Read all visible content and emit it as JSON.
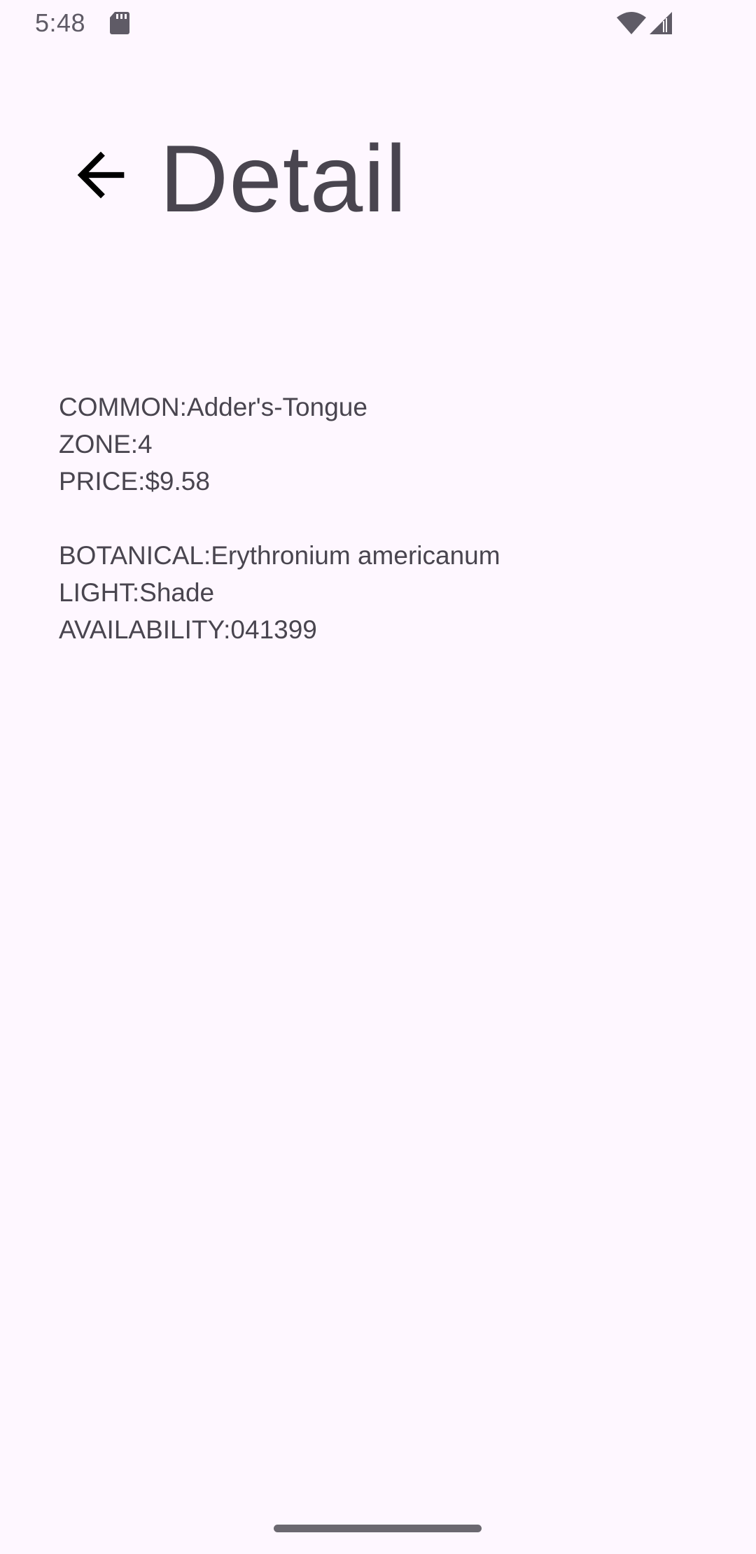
{
  "status_bar": {
    "time": "5:48",
    "icons": [
      "sd-card-icon",
      "wifi-icon",
      "cell-signal-icon"
    ]
  },
  "top_bar": {
    "back_icon": "arrow-back-icon",
    "title": "Detail"
  },
  "details": {
    "common": "COMMON:Adder's-Tongue",
    "zone": "ZONE:4",
    "price": "PRICE:$9.58",
    "botanical": "BOTANICAL:Erythronium americanum",
    "light": "LIGHT:Shade",
    "availability": "AVAILABILITY:041399"
  },
  "colors": {
    "background": "#FEF7FF",
    "text": "#49454F",
    "icon": "#000000"
  }
}
